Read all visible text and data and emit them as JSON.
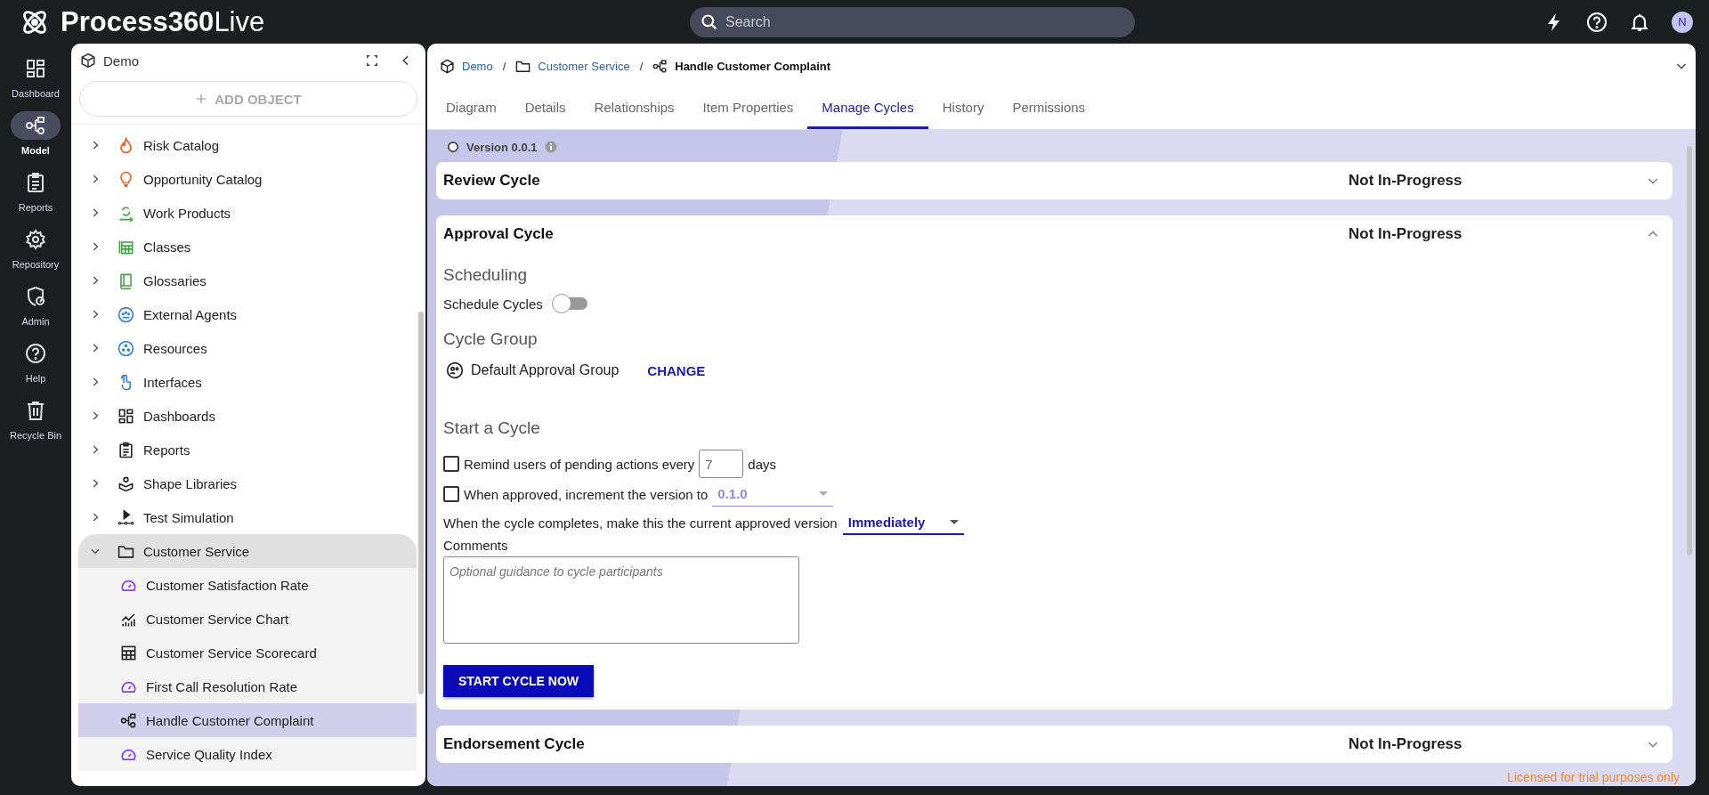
{
  "app": {
    "name_bold": "Process360",
    "name_light": "Live"
  },
  "search": {
    "placeholder": "Search"
  },
  "avatar": "N",
  "rail": [
    {
      "label": "Dashboard",
      "kind": "dashboard",
      "selected": false
    },
    {
      "label": "Model",
      "kind": "model",
      "selected": true
    },
    {
      "label": "Reports",
      "kind": "reports",
      "selected": false
    },
    {
      "label": "Repository",
      "kind": "repository",
      "selected": false
    },
    {
      "label": "Admin",
      "kind": "admin",
      "selected": false
    },
    {
      "label": "Help",
      "kind": "help",
      "selected": false
    },
    {
      "label": "Recycle Bin",
      "kind": "bin",
      "selected": false
    }
  ],
  "tree": {
    "title": "Demo",
    "add_button": "ADD OBJECT",
    "items": [
      {
        "label": "Risk Catalog",
        "kind": "risk",
        "expanded": false,
        "selected": false
      },
      {
        "label": "Opportunity Catalog",
        "kind": "opportunity",
        "expanded": false,
        "selected": false
      },
      {
        "label": "Work Products",
        "kind": "workproducts",
        "expanded": false,
        "selected": false
      },
      {
        "label": "Classes",
        "kind": "classes",
        "expanded": false,
        "selected": false
      },
      {
        "label": "Glossaries",
        "kind": "glossary",
        "expanded": false,
        "selected": false
      },
      {
        "label": "External Agents",
        "kind": "agents",
        "expanded": false,
        "selected": false
      },
      {
        "label": "Resources",
        "kind": "resources",
        "expanded": false,
        "selected": false
      },
      {
        "label": "Interfaces",
        "kind": "interfaces",
        "expanded": false,
        "selected": false
      },
      {
        "label": "Dashboards",
        "kind": "dashboard",
        "expanded": false,
        "selected": false
      },
      {
        "label": "Reports",
        "kind": "reports",
        "expanded": false,
        "selected": false
      },
      {
        "label": "Shape Libraries",
        "kind": "shapes",
        "expanded": false,
        "selected": false
      },
      {
        "label": "Test Simulation",
        "kind": "simulation",
        "expanded": false,
        "selected": false
      },
      {
        "label": "Customer Service",
        "kind": "folder",
        "expanded": true,
        "selected": false,
        "children": [
          {
            "label": "Customer Satisfaction Rate",
            "kind": "metric",
            "selected": false
          },
          {
            "label": "Customer Service Chart",
            "kind": "chart",
            "selected": false
          },
          {
            "label": "Customer Service Scorecard",
            "kind": "scorecard",
            "selected": false
          },
          {
            "label": "First Call Resolution Rate",
            "kind": "metric",
            "selected": false
          },
          {
            "label": "Handle Customer Complaint",
            "kind": "process",
            "selected": true
          },
          {
            "label": "Service Quality Index",
            "kind": "metric",
            "selected": false
          }
        ]
      }
    ]
  },
  "breadcrumb": [
    {
      "label": "Demo",
      "kind": "cube",
      "current": false
    },
    {
      "separator": "/",
      "label": "Customer Service",
      "kind": "folder",
      "current": false
    },
    {
      "separator": "/",
      "label": "Handle Customer Complaint",
      "kind": "process",
      "current": true
    }
  ],
  "tabs": [
    {
      "label": "Diagram",
      "selected": false
    },
    {
      "label": "Details",
      "selected": false
    },
    {
      "label": "Relationships",
      "selected": false
    },
    {
      "label": "Item Properties",
      "selected": false
    },
    {
      "label": "Manage Cycles",
      "selected": true
    },
    {
      "label": "History",
      "selected": false
    },
    {
      "label": "Permissions",
      "selected": false
    }
  ],
  "version": "Version 0.0.1",
  "cycles": [
    {
      "title": "Review Cycle",
      "status": "Not In-Progress",
      "expanded": false
    },
    {
      "title": "Approval Cycle",
      "status": "Not In-Progress",
      "expanded": true,
      "form": {
        "scheduling_heading": "Scheduling",
        "schedule": {
          "label": "Schedule Cycles",
          "on": false
        },
        "group_heading": "Cycle Group",
        "group_name": "Default Approval Group",
        "change_link": "CHANGE",
        "start_heading": "Start a Cycle",
        "remind": {
          "checked": false,
          "label": "Remind users of pending actions every",
          "value": "7",
          "unit": "days"
        },
        "increment": {
          "checked": false,
          "label": "When approved, increment the version to",
          "value": "0.1.0"
        },
        "completes": {
          "label": "When the cycle completes, make this the current approved version",
          "value": "Immediately"
        },
        "comments": {
          "label": "Comments",
          "placeholder": "Optional guidance to cycle participants"
        },
        "start_button": "START CYCLE NOW"
      }
    },
    {
      "title": "Endorsement Cycle",
      "status": "Not In-Progress",
      "expanded": false
    }
  ],
  "license_note": "Licensed for trial purposes only"
}
